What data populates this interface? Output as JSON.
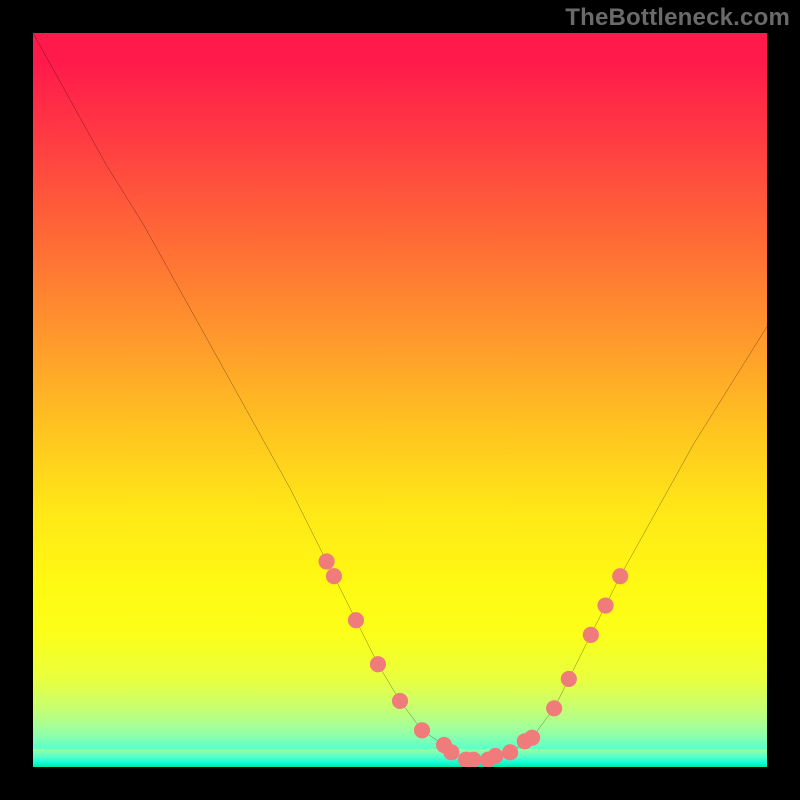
{
  "watermark": {
    "text": "TheBottleneck.com"
  },
  "chart_data": {
    "type": "line",
    "title": "",
    "xlabel": "",
    "ylabel": "",
    "xlim": [
      0,
      100
    ],
    "ylim": [
      0,
      100
    ],
    "grid": false,
    "legend": false,
    "series": [
      {
        "name": "bottleneck-curve",
        "color": "#000000",
        "x": [
          0,
          5,
          10,
          15,
          20,
          25,
          30,
          35,
          40,
          41,
          44,
          47,
          50,
          53,
          56,
          59,
          62,
          65,
          68,
          71,
          73,
          76,
          80,
          85,
          90,
          95,
          100
        ],
        "y": [
          100,
          91,
          82,
          74,
          65,
          56,
          47,
          38,
          28,
          26,
          20,
          14,
          9,
          5,
          3,
          1,
          1,
          2,
          4,
          8,
          12,
          18,
          26,
          35,
          44,
          52,
          60
        ]
      }
    ],
    "markers": [
      {
        "series": "bottleneck-curve",
        "x": 40,
        "y": 28,
        "color": "#f07b7b"
      },
      {
        "series": "bottleneck-curve",
        "x": 41,
        "y": 26,
        "color": "#f07b7b"
      },
      {
        "series": "bottleneck-curve",
        "x": 44,
        "y": 20,
        "color": "#f07b7b"
      },
      {
        "series": "bottleneck-curve",
        "x": 47,
        "y": 14,
        "color": "#f07b7b"
      },
      {
        "series": "bottleneck-curve",
        "x": 50,
        "y": 9,
        "color": "#f07b7b"
      },
      {
        "series": "bottleneck-curve",
        "x": 53,
        "y": 5,
        "color": "#f07b7b"
      },
      {
        "series": "bottleneck-curve",
        "x": 56,
        "y": 3,
        "color": "#f07b7b"
      },
      {
        "series": "bottleneck-curve",
        "x": 57,
        "y": 2,
        "color": "#f07b7b"
      },
      {
        "series": "bottleneck-curve",
        "x": 59,
        "y": 1,
        "color": "#f07b7b"
      },
      {
        "series": "bottleneck-curve",
        "x": 60,
        "y": 1,
        "color": "#f07b7b"
      },
      {
        "series": "bottleneck-curve",
        "x": 62,
        "y": 1,
        "color": "#f07b7b"
      },
      {
        "series": "bottleneck-curve",
        "x": 63,
        "y": 1.5,
        "color": "#f07b7b"
      },
      {
        "series": "bottleneck-curve",
        "x": 65,
        "y": 2,
        "color": "#f07b7b"
      },
      {
        "series": "bottleneck-curve",
        "x": 67,
        "y": 3.5,
        "color": "#f07b7b"
      },
      {
        "series": "bottleneck-curve",
        "x": 68,
        "y": 4,
        "color": "#f07b7b"
      },
      {
        "series": "bottleneck-curve",
        "x": 71,
        "y": 8,
        "color": "#f07b7b"
      },
      {
        "series": "bottleneck-curve",
        "x": 73,
        "y": 12,
        "color": "#f07b7b"
      },
      {
        "series": "bottleneck-curve",
        "x": 76,
        "y": 18,
        "color": "#f07b7b"
      },
      {
        "series": "bottleneck-curve",
        "x": 78,
        "y": 22,
        "color": "#f07b7b"
      },
      {
        "series": "bottleneck-curve",
        "x": 80,
        "y": 26,
        "color": "#f07b7b"
      }
    ],
    "gradient_meaning": "red_high_bottleneck_green_low_bottleneck"
  }
}
